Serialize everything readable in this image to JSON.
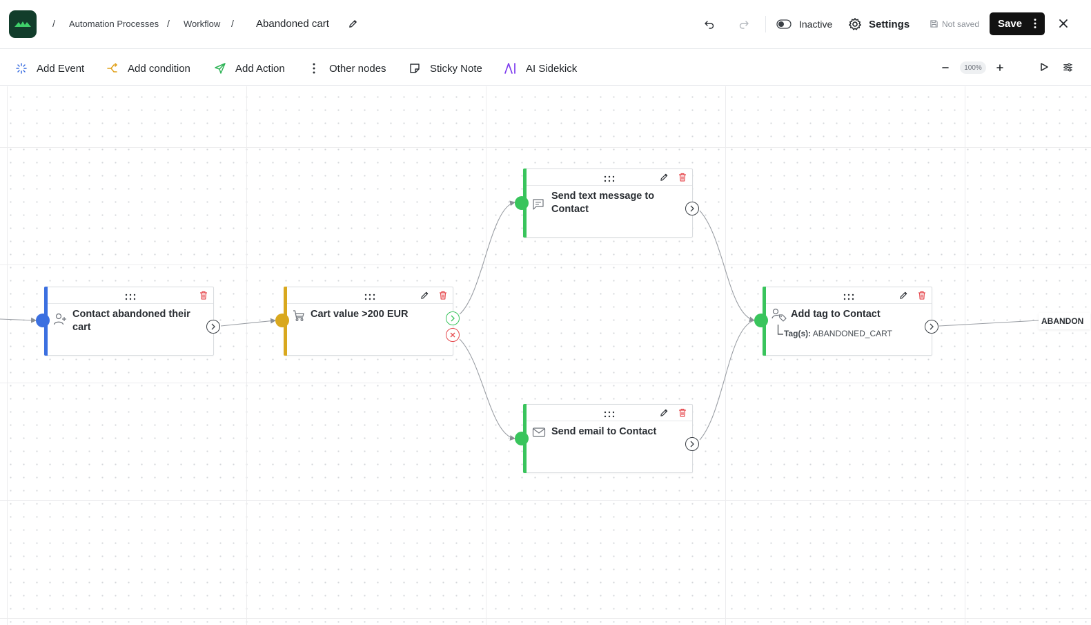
{
  "header": {
    "breadcrumbs": [
      "Automation Processes",
      "Workflow"
    ],
    "workflow_name": "Abandoned cart",
    "status_label": "Inactive",
    "settings_label": "Settings",
    "save_state": "Not saved",
    "save_label": "Save"
  },
  "toolbar": {
    "add_event": "Add Event",
    "add_condition": "Add condition",
    "add_action": "Add Action",
    "other_nodes": "Other nodes",
    "sticky_note": "Sticky Note",
    "ai_sidekick": "AI Sidekick",
    "zoom": "100%"
  },
  "nodes": {
    "trigger": {
      "title": "Contact abandoned their cart",
      "color": "#3b6fe0",
      "icon": "user-plus-icon"
    },
    "condition": {
      "title": "Cart value >200 EUR",
      "color": "#d9a81e",
      "icon": "cart-icon"
    },
    "sms": {
      "title": "Send text message to Contact",
      "color": "#39c45c",
      "icon": "message-icon"
    },
    "email": {
      "title": "Send email to Contact",
      "color": "#39c45c",
      "icon": "mail-icon"
    },
    "tag": {
      "title": "Add tag to Contact",
      "sub_label": "Tag(s):",
      "sub_value": "ABANDONED_CART",
      "color": "#39c45c",
      "icon": "tag-user-icon"
    }
  },
  "offscreen_chip": "ABANDON",
  "colors": {
    "accent": "#39c45c",
    "danger": "#e5484d",
    "brand": "#123d2b",
    "event": "#3b6fe0",
    "condition": "#e0a019",
    "ai": "#7c3aed"
  }
}
